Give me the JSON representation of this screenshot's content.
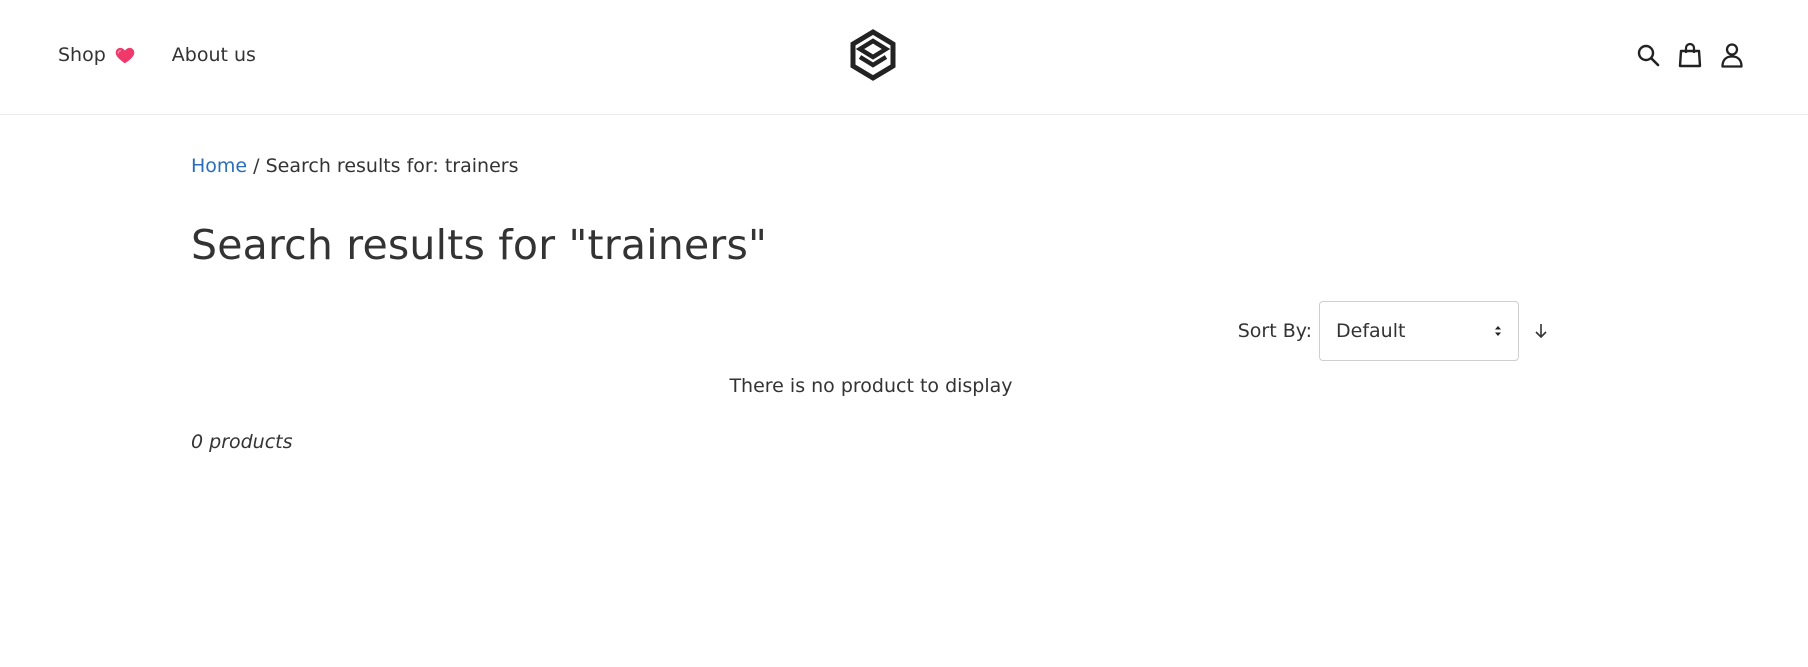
{
  "header": {
    "nav": [
      {
        "label": "Shop",
        "icon": "heart-icon"
      },
      {
        "label": "About us"
      }
    ],
    "logo_icon": "layers-logo-icon",
    "icons": [
      "search-icon",
      "shopping-bag-icon",
      "user-icon"
    ]
  },
  "breadcrumb": {
    "home": "Home",
    "separator": "/",
    "current": "Search results for: trainers"
  },
  "page_title": "Search results for \"trainers\"",
  "sort": {
    "label": "Sort By:",
    "selected": "Default",
    "direction_icon": "arrow-down-icon"
  },
  "empty_message": "There is no product to display",
  "product_count": "0 products",
  "colors": {
    "link": "#2a6ebb",
    "text": "#333333",
    "heart": "#f0386b"
  }
}
